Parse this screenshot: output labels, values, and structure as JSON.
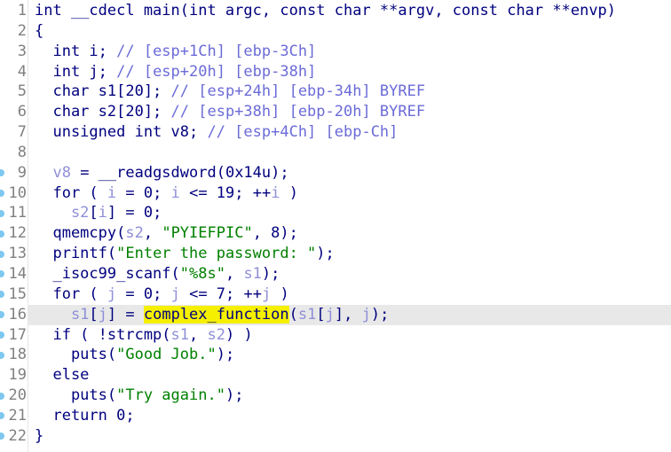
{
  "view": {
    "name": "pseudocode-view",
    "background": "#ffffff",
    "gutter_rule_color": "#e6e6e6",
    "current_line_background": "#e8e8e8",
    "highlight_background": "#f5f000",
    "marker_color": "#7ec8f0"
  },
  "colors": {
    "keyword": "#00007f",
    "variable": "#8f8fd8",
    "comment": "#6b6bd8",
    "string": "#008000",
    "number": "#00007f",
    "lineno": "#808080"
  },
  "current_line": 16,
  "highlighted_token": "complex_function",
  "lines": [
    {
      "n": "1",
      "marker": false,
      "current": false,
      "tokens": [
        {
          "c": "kw",
          "t": "int __cdecl main(int argc, const char **argv, const char **envp)"
        }
      ]
    },
    {
      "n": "2",
      "marker": false,
      "current": false,
      "tokens": [
        {
          "c": "punc",
          "t": "{"
        }
      ]
    },
    {
      "n": "3",
      "marker": false,
      "current": false,
      "tokens": [
        {
          "c": "kw",
          "t": "  int i; "
        },
        {
          "c": "cmt",
          "t": "// [esp+1Ch] [ebp-3Ch]"
        }
      ]
    },
    {
      "n": "4",
      "marker": false,
      "current": false,
      "tokens": [
        {
          "c": "kw",
          "t": "  int j; "
        },
        {
          "c": "cmt",
          "t": "// [esp+20h] [ebp-38h]"
        }
      ]
    },
    {
      "n": "5",
      "marker": false,
      "current": false,
      "tokens": [
        {
          "c": "kw",
          "t": "  char s1[20]; "
        },
        {
          "c": "cmt",
          "t": "// [esp+24h] [ebp-34h] BYREF"
        }
      ]
    },
    {
      "n": "6",
      "marker": false,
      "current": false,
      "tokens": [
        {
          "c": "kw",
          "t": "  char s2[20]; "
        },
        {
          "c": "cmt",
          "t": "// [esp+38h] [ebp-20h] BYREF"
        }
      ]
    },
    {
      "n": "7",
      "marker": false,
      "current": false,
      "tokens": [
        {
          "c": "kw",
          "t": "  unsigned int v8; "
        },
        {
          "c": "cmt",
          "t": "// [esp+4Ch] [ebp-Ch]"
        }
      ]
    },
    {
      "n": "8",
      "marker": false,
      "current": false,
      "tokens": []
    },
    {
      "n": "9",
      "marker": true,
      "current": false,
      "tokens": [
        {
          "c": "var",
          "t": "  v8"
        },
        {
          "c": "kw",
          "t": " = __readgsdword("
        },
        {
          "c": "num",
          "t": "0x14u"
        },
        {
          "c": "kw",
          "t": ");"
        }
      ]
    },
    {
      "n": "10",
      "marker": true,
      "current": false,
      "tokens": [
        {
          "c": "kw",
          "t": "  for ( "
        },
        {
          "c": "var",
          "t": "i"
        },
        {
          "c": "kw",
          "t": " = "
        },
        {
          "c": "num",
          "t": "0"
        },
        {
          "c": "kw",
          "t": "; "
        },
        {
          "c": "var",
          "t": "i"
        },
        {
          "c": "kw",
          "t": " <= "
        },
        {
          "c": "num",
          "t": "19"
        },
        {
          "c": "kw",
          "t": "; ++"
        },
        {
          "c": "var",
          "t": "i"
        },
        {
          "c": "kw",
          "t": " )"
        }
      ]
    },
    {
      "n": "11",
      "marker": true,
      "current": false,
      "tokens": [
        {
          "c": "var",
          "t": "    s2"
        },
        {
          "c": "kw",
          "t": "["
        },
        {
          "c": "var",
          "t": "i"
        },
        {
          "c": "kw",
          "t": "] = "
        },
        {
          "c": "num",
          "t": "0"
        },
        {
          "c": "kw",
          "t": ";"
        }
      ]
    },
    {
      "n": "12",
      "marker": true,
      "current": false,
      "tokens": [
        {
          "c": "kw",
          "t": "  qmemcpy("
        },
        {
          "c": "var",
          "t": "s2"
        },
        {
          "c": "kw",
          "t": ", "
        },
        {
          "c": "str",
          "t": "\"PYIEFPIC\""
        },
        {
          "c": "kw",
          "t": ", "
        },
        {
          "c": "num",
          "t": "8"
        },
        {
          "c": "kw",
          "t": ");"
        }
      ]
    },
    {
      "n": "13",
      "marker": true,
      "current": false,
      "tokens": [
        {
          "c": "kw",
          "t": "  printf("
        },
        {
          "c": "str",
          "t": "\"Enter the password: \""
        },
        {
          "c": "kw",
          "t": ");"
        }
      ]
    },
    {
      "n": "14",
      "marker": true,
      "current": false,
      "tokens": [
        {
          "c": "kw",
          "t": "  _isoc99_scanf("
        },
        {
          "c": "str",
          "t": "\"%8s\""
        },
        {
          "c": "kw",
          "t": ", "
        },
        {
          "c": "var",
          "t": "s1"
        },
        {
          "c": "kw",
          "t": ");"
        }
      ]
    },
    {
      "n": "15",
      "marker": true,
      "current": false,
      "tokens": [
        {
          "c": "kw",
          "t": "  for ( "
        },
        {
          "c": "var",
          "t": "j"
        },
        {
          "c": "kw",
          "t": " = "
        },
        {
          "c": "num",
          "t": "0"
        },
        {
          "c": "kw",
          "t": "; "
        },
        {
          "c": "var",
          "t": "j"
        },
        {
          "c": "kw",
          "t": " <= "
        },
        {
          "c": "num",
          "t": "7"
        },
        {
          "c": "kw",
          "t": "; ++"
        },
        {
          "c": "var",
          "t": "j"
        },
        {
          "c": "kw",
          "t": " )"
        }
      ]
    },
    {
      "n": "16",
      "marker": true,
      "current": true,
      "tokens": [
        {
          "c": "var",
          "t": "    s1"
        },
        {
          "c": "kw",
          "t": "["
        },
        {
          "c": "var",
          "t": "j"
        },
        {
          "c": "kw",
          "t": "] = "
        },
        {
          "c": "hl",
          "t": "complex_function"
        },
        {
          "c": "kw",
          "t": "("
        },
        {
          "c": "var",
          "t": "s1"
        },
        {
          "c": "kw",
          "t": "["
        },
        {
          "c": "var",
          "t": "j"
        },
        {
          "c": "kw",
          "t": "], "
        },
        {
          "c": "var",
          "t": "j"
        },
        {
          "c": "kw",
          "t": ");"
        }
      ]
    },
    {
      "n": "17",
      "marker": true,
      "current": false,
      "tokens": [
        {
          "c": "kw",
          "t": "  if ( !strcmp("
        },
        {
          "c": "var",
          "t": "s1"
        },
        {
          "c": "kw",
          "t": ", "
        },
        {
          "c": "var",
          "t": "s2"
        },
        {
          "c": "kw",
          "t": ") )"
        }
      ]
    },
    {
      "n": "18",
      "marker": true,
      "current": false,
      "tokens": [
        {
          "c": "kw",
          "t": "    puts("
        },
        {
          "c": "str",
          "t": "\"Good Job.\""
        },
        {
          "c": "kw",
          "t": ");"
        }
      ]
    },
    {
      "n": "19",
      "marker": false,
      "current": false,
      "tokens": [
        {
          "c": "kw",
          "t": "  else"
        }
      ]
    },
    {
      "n": "20",
      "marker": true,
      "current": false,
      "tokens": [
        {
          "c": "kw",
          "t": "    puts("
        },
        {
          "c": "str",
          "t": "\"Try again.\""
        },
        {
          "c": "kw",
          "t": ");"
        }
      ]
    },
    {
      "n": "21",
      "marker": true,
      "current": false,
      "tokens": [
        {
          "c": "kw",
          "t": "  return "
        },
        {
          "c": "num",
          "t": "0"
        },
        {
          "c": "kw",
          "t": ";"
        }
      ]
    },
    {
      "n": "22",
      "marker": true,
      "current": false,
      "tokens": [
        {
          "c": "punc",
          "t": "}"
        }
      ]
    }
  ]
}
